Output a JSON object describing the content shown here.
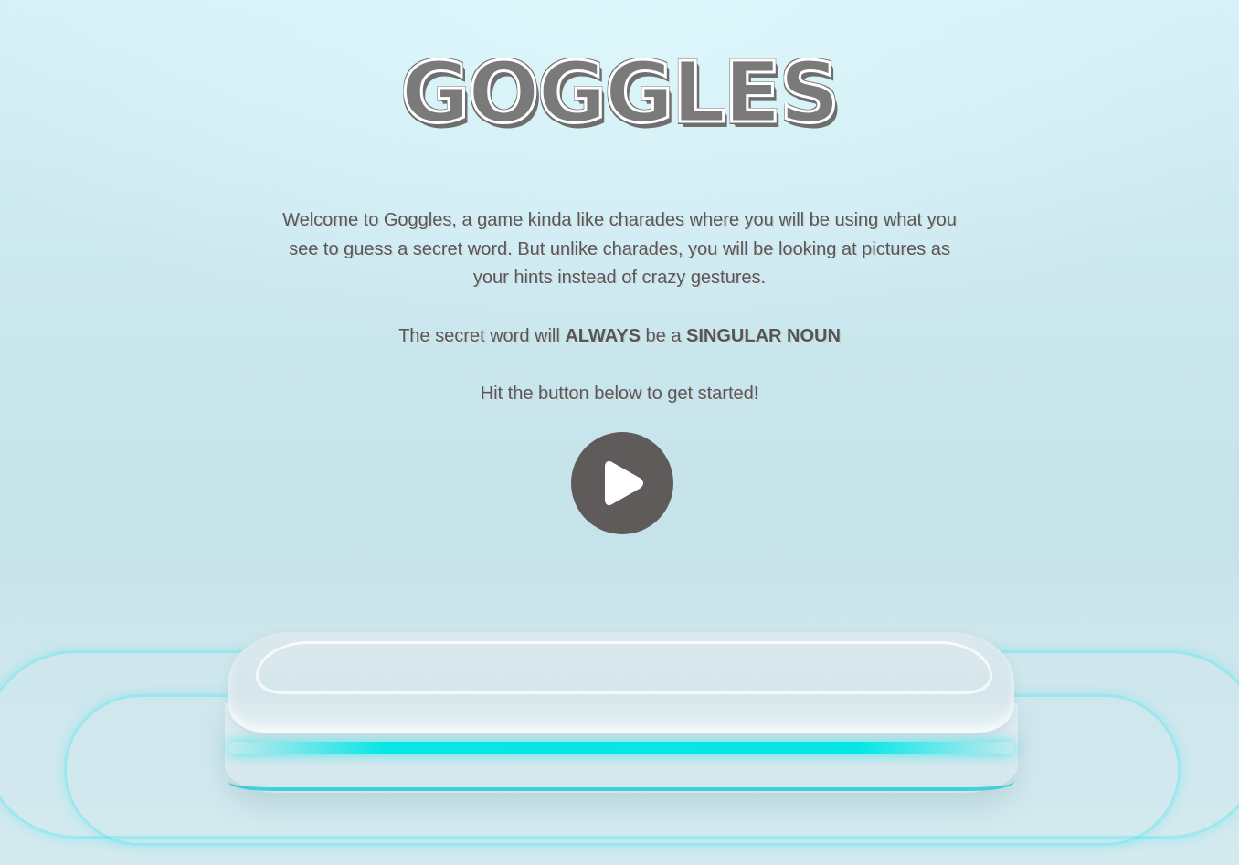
{
  "logo": {
    "title": "GOGGLES"
  },
  "intro": {
    "text": "Welcome to Goggles, a game kinda like charades where you will be using what you see to guess a secret word. But unlike charades, you will be looking at pictures as your hints instead of crazy gestures."
  },
  "rule": {
    "prefix": "The secret word will ",
    "emphasis_1": "ALWAYS",
    "middle": " be a ",
    "emphasis_2": "SINGULAR NOUN"
  },
  "cta": {
    "text": "Hit the button below to get started!"
  },
  "play_button": {
    "icon": "play-icon"
  },
  "colors": {
    "text": "#5a5656",
    "button": "#5f5b5b",
    "glow": "#03e6e6"
  }
}
